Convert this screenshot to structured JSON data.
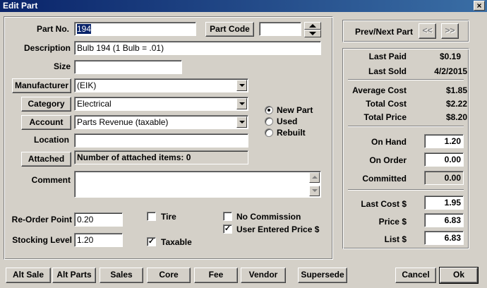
{
  "window": {
    "title": "Edit Part",
    "close_glyph": "×"
  },
  "part_no": {
    "label": "Part No.",
    "value": "194"
  },
  "part_code": {
    "button": "Part Code",
    "value": ""
  },
  "description": {
    "label": "Description",
    "value": "Bulb 194 (1 Bulb = .01)"
  },
  "size": {
    "label": "Size",
    "value": ""
  },
  "manufacturer": {
    "button": "Manufacturer",
    "value": "(EIK)"
  },
  "category": {
    "button": "Category",
    "value": "Electrical"
  },
  "account": {
    "button": "Account",
    "value": "Parts Revenue (taxable)"
  },
  "location": {
    "label": "Location",
    "value": ""
  },
  "attached": {
    "button": "Attached",
    "text": "Number of attached items: 0"
  },
  "comment": {
    "label": "Comment",
    "value": ""
  },
  "condition": {
    "options": [
      {
        "label": "New Part",
        "selected": true
      },
      {
        "label": "Used",
        "selected": false
      },
      {
        "label": "Rebuilt",
        "selected": false
      }
    ]
  },
  "reorder_point": {
    "label": "Re-Order Point",
    "value": "0.20"
  },
  "stocking_level": {
    "label": "Stocking Level",
    "value": "1.20"
  },
  "checks": {
    "tire": {
      "label": "Tire",
      "checked": false
    },
    "taxable": {
      "label": "Taxable",
      "checked": true
    },
    "no_commission": {
      "label": "No Commission",
      "checked": false
    },
    "user_entered_price": {
      "label": "User Entered Price $",
      "checked": true
    },
    "check_glyph": "✓"
  },
  "nav": {
    "label": "Prev/Next Part",
    "prev": "<<",
    "next": ">>"
  },
  "stats": {
    "last_paid": {
      "label": "Last Paid",
      "value": "$0.19"
    },
    "last_sold": {
      "label": "Last Sold",
      "value": "4/2/2015"
    },
    "average_cost": {
      "label": "Average Cost",
      "value": "$1.85"
    },
    "total_cost": {
      "label": "Total Cost",
      "value": "$2.22"
    },
    "total_price": {
      "label": "Total Price",
      "value": "$8.20"
    }
  },
  "inventory": {
    "on_hand": {
      "label": "On Hand",
      "value": "1.20"
    },
    "on_order": {
      "label": "On Order",
      "value": "0.00"
    },
    "committed": {
      "label": "Committed",
      "value": "0.00"
    }
  },
  "pricing": {
    "last_cost": {
      "label": "Last Cost $",
      "value": "1.95"
    },
    "price": {
      "label": "Price $",
      "value": "6.83"
    },
    "list": {
      "label": "List $",
      "value": "6.83"
    }
  },
  "footer": {
    "alt_sale": "Alt Sale",
    "alt_parts": "Alt Parts",
    "sales": "Sales",
    "core": "Core",
    "fee": "Fee",
    "vendor": "Vendor",
    "supersede": "Supersede",
    "cancel": "Cancel",
    "ok": "Ok"
  }
}
